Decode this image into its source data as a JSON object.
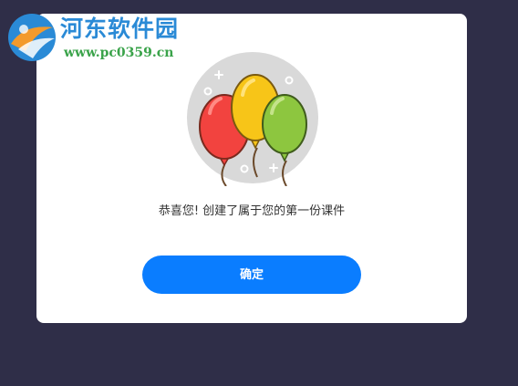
{
  "watermark": {
    "title": "河东软件园",
    "url": "www.pc0359.cn"
  },
  "dialog": {
    "message": "恭喜您! 创建了属于您的第一份课件",
    "confirm_label": "确定",
    "illustration": "balloons-icon"
  },
  "colors": {
    "backdrop": "#2f2e48",
    "dialog_bg": "#ffffff",
    "button_bg": "#0a7dff",
    "balloon_red": "#f2433f",
    "balloon_yellow": "#f7c518",
    "balloon_green": "#8dc63f",
    "circle_bg": "#d9d9d9"
  }
}
